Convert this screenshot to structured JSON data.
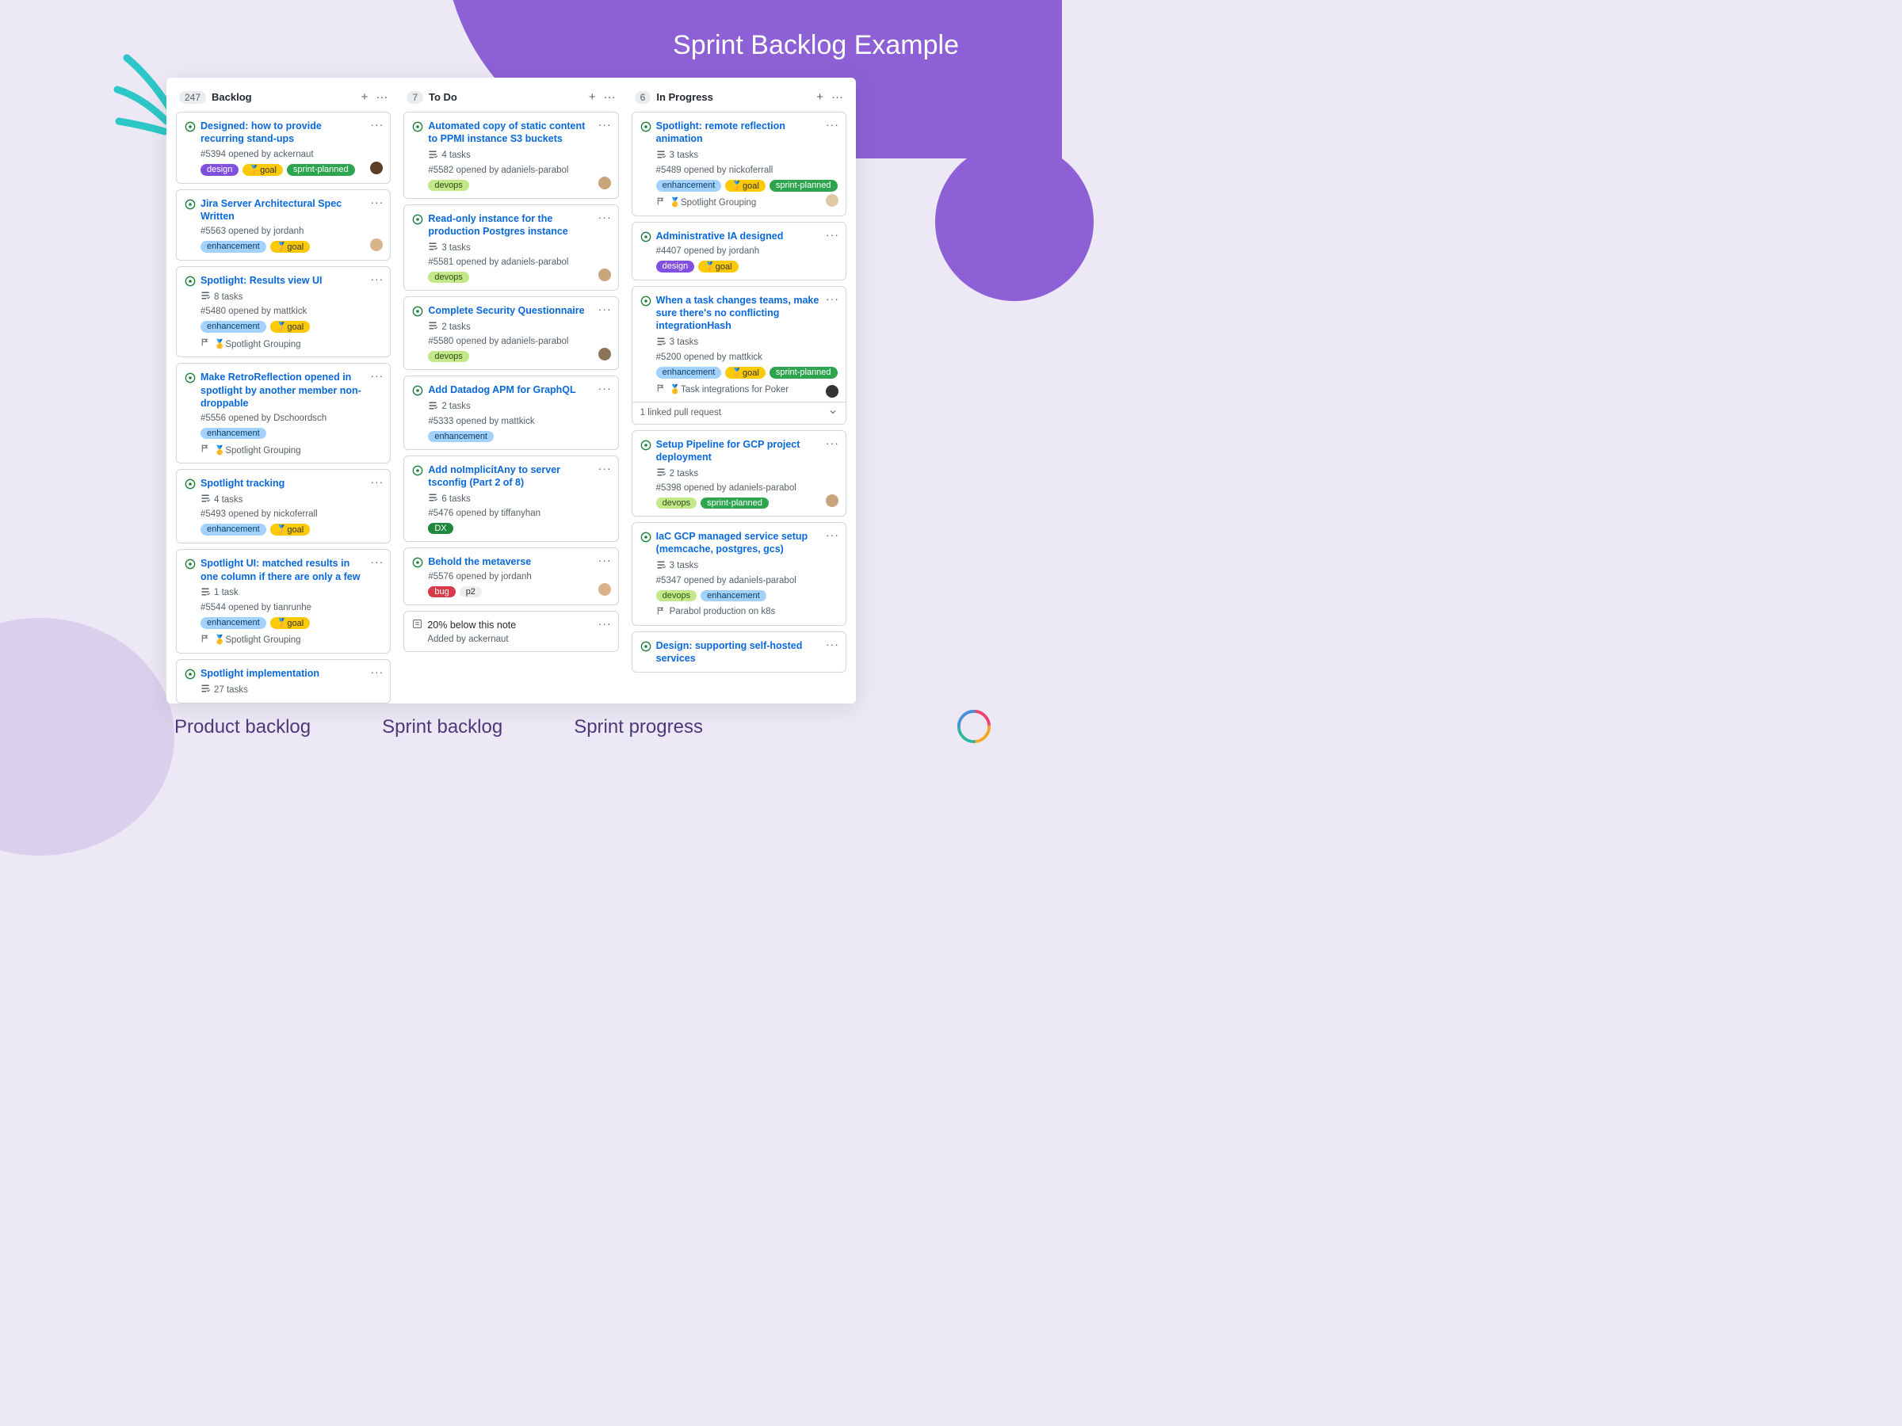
{
  "page_title": "Sprint Backlog Example",
  "captions": [
    "Product backlog",
    "Sprint backlog",
    "Sprint progress"
  ],
  "label_colors": {
    "design": {
      "bg": "#8250df",
      "fg": "#fff"
    },
    "goal": {
      "bg": "#fbca04",
      "fg": "#333"
    },
    "sprint-planned": {
      "bg": "#2da44e",
      "fg": "#fff"
    },
    "enhancement": {
      "bg": "#a2d2fb",
      "fg": "#0a3e68"
    },
    "devops": {
      "bg": "#c2e88a",
      "fg": "#2d5016"
    },
    "DX": {
      "bg": "#1f883d",
      "fg": "#fff"
    },
    "bug": {
      "bg": "#d73a49",
      "fg": "#fff"
    },
    "p2": {
      "bg": "#ededed",
      "fg": "#333"
    }
  },
  "columns": [
    {
      "count": "247",
      "title": "Backlog",
      "cards": [
        {
          "title": "Designed: how to provide recurring stand-ups",
          "id": "#5394",
          "author": "ackernaut",
          "labels": [
            "design",
            "goal",
            "sprint-planned"
          ],
          "avatar": "#5a3e28",
          "avatar_bottom": 10
        },
        {
          "title": "Jira Server Architectural Spec Written",
          "id": "#5563",
          "author": "jordanh",
          "labels": [
            "enhancement",
            "goal"
          ],
          "avatar": "#d9b38c",
          "avatar_bottom": 10
        },
        {
          "title": "Spotlight: Results view UI",
          "id": "#5480",
          "author": "mattkick",
          "tasks": "8 tasks",
          "labels": [
            "enhancement",
            "goal"
          ],
          "milestone": "🥇Spotlight Grouping"
        },
        {
          "title": "Make RetroReflection opened in spotlight by another member non-droppable",
          "id": "#5556",
          "author": "Dschoordsch",
          "labels": [
            "enhancement"
          ],
          "milestone": "🥇Spotlight Grouping"
        },
        {
          "title": "Spotlight tracking",
          "id": "#5493",
          "author": "nickoferrall",
          "tasks": "4 tasks",
          "labels": [
            "enhancement",
            "goal"
          ]
        },
        {
          "title": "Spotlight UI: matched results in one column if there are only a few",
          "id": "#5544",
          "author": "tianrunhe",
          "tasks": "1 task",
          "labels": [
            "enhancement",
            "goal"
          ],
          "milestone": "🥇Spotlight Grouping"
        },
        {
          "title": "Spotlight implementation",
          "tasks": "27 tasks"
        }
      ]
    },
    {
      "count": "7",
      "title": "To Do",
      "cards": [
        {
          "title": "Automated copy of static content to PPMI instance S3 buckets",
          "id": "#5582",
          "author": "adaniels-parabol",
          "tasks": "4 tasks",
          "labels": [
            "devops"
          ],
          "avatar": "#c9a57b",
          "avatar_bottom": 10
        },
        {
          "title": "Read-only instance for the production Postgres instance",
          "id": "#5581",
          "author": "adaniels-parabol",
          "tasks": "3 tasks",
          "labels": [
            "devops"
          ],
          "avatar": "#c9a57b",
          "avatar_bottom": 10
        },
        {
          "title": "Complete Security Questionnaire",
          "id": "#5580",
          "author": "adaniels-parabol",
          "tasks": "2 tasks",
          "labels": [
            "devops"
          ],
          "avatar": "#8b7355",
          "avatar_bottom": 10
        },
        {
          "title": "Add Datadog APM for GraphQL",
          "id": "#5333",
          "author": "mattkick",
          "tasks": "2 tasks",
          "labels": [
            "enhancement"
          ]
        },
        {
          "title": "Add noImplicitAny to server tsconfig (Part 2 of 8)",
          "id": "#5476",
          "author": "tiffanyhan",
          "tasks": "6 tasks",
          "labels": [
            "DX"
          ]
        },
        {
          "title": "Behold the metaverse",
          "id": "#5576",
          "author": "jordanh",
          "labels": [
            "bug",
            "p2"
          ],
          "avatar": "#d9b38c",
          "avatar_bottom": 10
        }
      ],
      "note": {
        "text": "20% below this note",
        "author": "ackernaut"
      }
    },
    {
      "count": "6",
      "title": "In Progress",
      "cards": [
        {
          "title": "Spotlight: remote reflection animation",
          "id": "#5489",
          "author": "nickoferrall",
          "tasks": "3 tasks",
          "labels": [
            "enhancement",
            "goal",
            "sprint-planned"
          ],
          "milestone": "🥇Spotlight Grouping",
          "avatar": "#e0c9a6",
          "avatar_bottom": 10
        },
        {
          "title": "Administrative IA designed",
          "id": "#4407",
          "author": "jordanh",
          "labels": [
            "design",
            "goal"
          ]
        },
        {
          "title": "When a task changes teams, make sure there's no conflicting integrationHash",
          "id": "#5200",
          "author": "mattkick",
          "tasks": "3 tasks",
          "labels": [
            "enhancement",
            "goal",
            "sprint-planned"
          ],
          "milestone": "🥇Task integrations for Poker",
          "avatar": "#333",
          "avatar_bottom": 32,
          "linked_pr": "1 linked pull request"
        },
        {
          "title": "Setup Pipeline for GCP project deployment",
          "id": "#5398",
          "author": "adaniels-parabol",
          "tasks": "2 tasks",
          "labels": [
            "devops",
            "sprint-planned"
          ],
          "avatar": "#c9a57b",
          "avatar_bottom": 10
        },
        {
          "title": "IaC GCP managed service setup (memcache, postgres, gcs)",
          "id": "#5347",
          "author": "adaniels-parabol",
          "tasks": "3 tasks",
          "labels": [
            "devops",
            "enhancement"
          ],
          "milestone": "Parabol production on k8s"
        },
        {
          "title": "Design: supporting self-hosted services"
        }
      ]
    }
  ],
  "goal_prefix": "🥇"
}
